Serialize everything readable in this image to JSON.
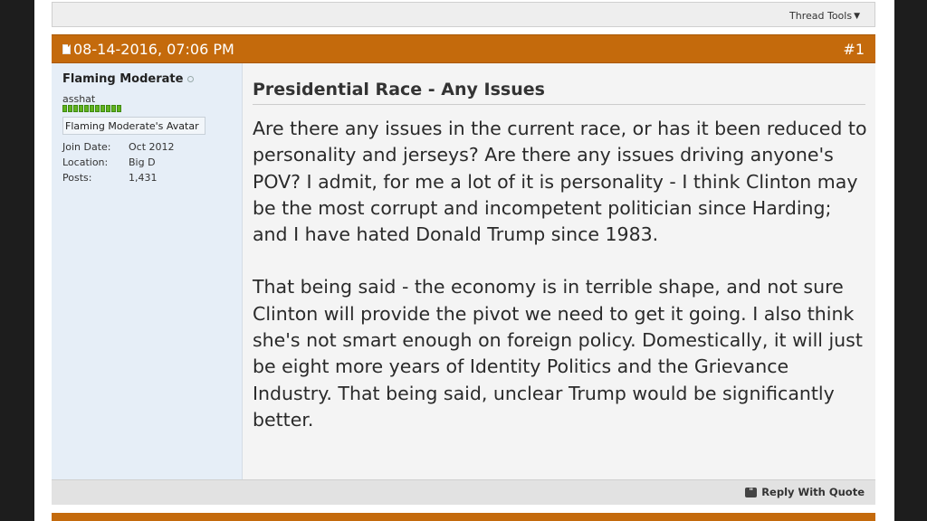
{
  "toolbar": {
    "thread_tools_label": "Thread Tools"
  },
  "post": {
    "date": "08-14-2016, 07:06 PM",
    "number": "#1",
    "title": "Presidential Race - Any Issues",
    "paragraphs": [
      "Are there any issues in the current race, or has it been reduced to personality and jerseys? Are there any issues driving anyone's POV? I admit, for me a lot of it is personality - I think Clinton may be the most corrupt and incompetent politician since Harding; and I have hated Donald Trump since 1983.",
      "That being said - the economy is in terrible shape, and not sure Clinton will provide the pivot we need to get it going. I also think she's not smart enough on foreign policy. Domestically, it will just be eight more years of Identity Politics and the Grievance Industry. That being said, unclear Trump would be significantly better."
    ],
    "reply_with_quote_label": "Reply With Quote"
  },
  "user": {
    "name": "Flaming Moderate",
    "title": "asshat",
    "reputation_pips": 11,
    "avatar_alt": "Flaming Moderate's Avatar",
    "stats": [
      {
        "key": "Join Date:",
        "value": "Oct 2012"
      },
      {
        "key": "Location:",
        "value": "Big D"
      },
      {
        "key": "Posts:",
        "value": "1,431"
      }
    ]
  },
  "colors": {
    "header_orange": "#c46a0c",
    "userinfo_bg": "#e6eef7",
    "reputation_green": "#62b31f"
  },
  "icons": {
    "caret": "caret-down-icon",
    "post": "post-document-icon",
    "online_status": "status-dot-icon",
    "quote": "quote-icon"
  }
}
